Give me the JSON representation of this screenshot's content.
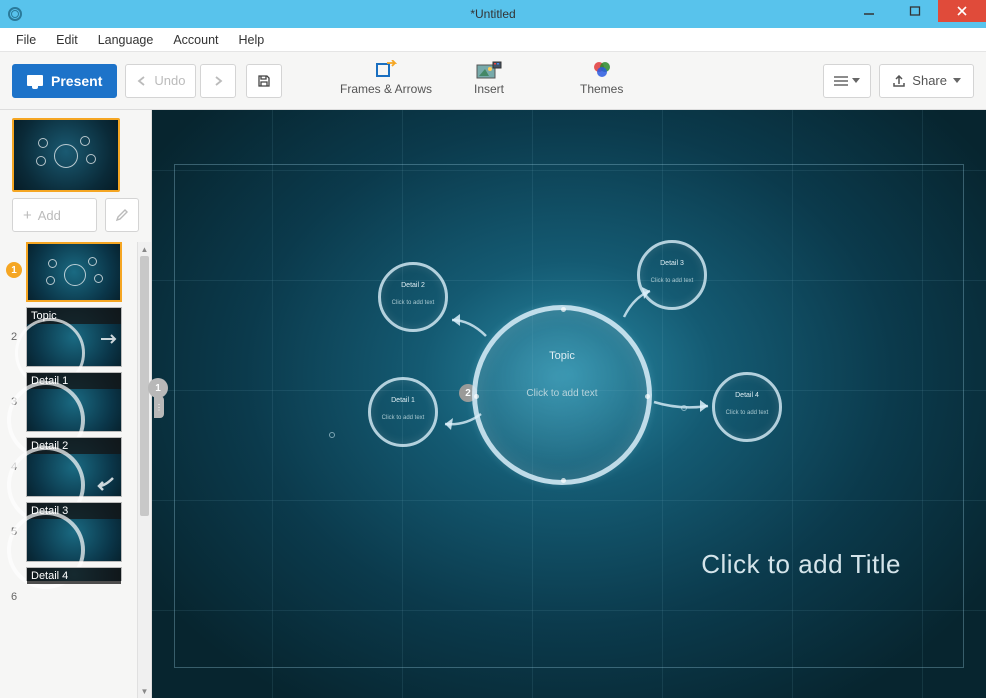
{
  "window": {
    "title": "*Untitled"
  },
  "menu": {
    "items": [
      "File",
      "Edit",
      "Language",
      "Account",
      "Help"
    ]
  },
  "toolbar": {
    "present": "Present",
    "undo": "Undo",
    "frames": "Frames & Arrows",
    "insert": "Insert",
    "themes": "Themes",
    "share": "Share"
  },
  "sidebar": {
    "add": "Add",
    "overview_badge": "1",
    "collapse_badge": "1",
    "items": [
      {
        "num": "1",
        "label": "",
        "selected": true
      },
      {
        "num": "2",
        "label": "Topic"
      },
      {
        "num": "3",
        "label": "Detail 1"
      },
      {
        "num": "4",
        "label": "Detail 2"
      },
      {
        "num": "5",
        "label": "Detail 3"
      },
      {
        "num": "6",
        "label": "Detail 4"
      }
    ]
  },
  "canvas": {
    "step_badge": "2",
    "title_placeholder": "Click to add Title",
    "main": {
      "title": "Topic",
      "subtitle": "Click to add text"
    },
    "details": [
      {
        "label": "Detail 1",
        "sub": "Click to add text"
      },
      {
        "label": "Detail 2",
        "sub": "Click to add text"
      },
      {
        "label": "Detail 3",
        "sub": "Click to add text"
      },
      {
        "label": "Detail 4",
        "sub": "Click to add text"
      }
    ]
  },
  "colors": {
    "accent": "#1d73c9",
    "selection": "#f5a623",
    "titlebar": "#58c3ec",
    "close": "#e04b3a"
  }
}
